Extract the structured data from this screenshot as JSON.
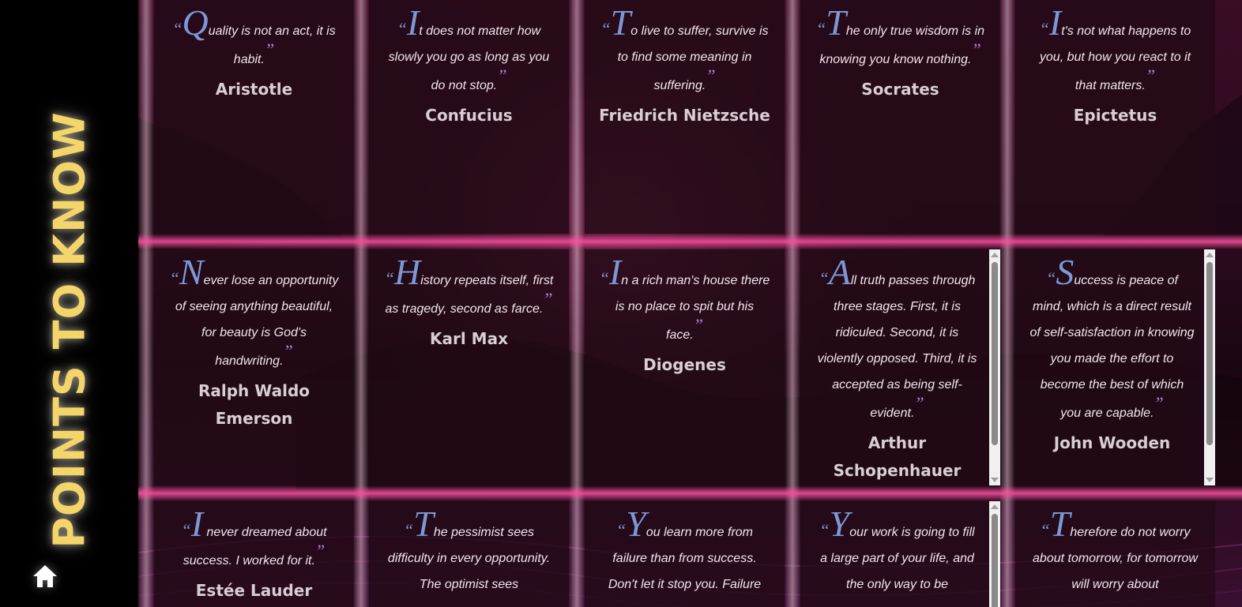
{
  "sidebar": {
    "title": "POINTS TO KNOW",
    "home_icon": "home-icon"
  },
  "colors": {
    "title": "#f3d56a",
    "quote_mark_open": "#7f92c9",
    "quote_mark_close": "#b680c7",
    "accent_glow": "#ff4fa3"
  },
  "quotes": [
    {
      "first": "Q",
      "rest": "uality is not an act, it is habit.",
      "author": "Aristotle"
    },
    {
      "first": "I",
      "rest": "t does not matter how slowly you go as long as you do not stop.",
      "author": "Confucius"
    },
    {
      "first": "T",
      "rest": "o live to suffer, survive is to find some meaning in suffering.",
      "author": "Friedrich Nietzsche"
    },
    {
      "first": "T",
      "rest": "he only true wisdom is in knowing you know nothing.",
      "author": "Socrates"
    },
    {
      "first": "I",
      "rest": "t's not what happens to you, but how you react to it that matters.",
      "author": "Epictetus"
    },
    {
      "first": "N",
      "rest": "ever lose an opportunity of seeing anything beautiful, for beauty is God's handwriting.",
      "author": "Ralph Waldo Emerson"
    },
    {
      "first": "H",
      "rest": "istory repeats itself, first as tragedy, second as farce.",
      "author": "Karl Max"
    },
    {
      "first": "I",
      "rest": "n a rich man's house there is no place to spit but his face.",
      "author": "Diogenes"
    },
    {
      "first": "A",
      "rest": "ll truth passes through three stages. First, it is ridiculed. Second, it is violently opposed. Third, it is accepted as being self-evident.",
      "author": "Arthur Schopenhauer"
    },
    {
      "first": "S",
      "rest": "uccess is peace of mind, which is a direct result of self-satisfaction in knowing you made the effort to become the best of which you are capable.",
      "author": "John Wooden"
    },
    {
      "first": "I",
      "rest": " never dreamed about success. I worked for it.",
      "author": "Estée Lauder"
    },
    {
      "first": "T",
      "rest": "he pessimist sees difficulty in every opportunity. The optimist sees",
      "author": ""
    },
    {
      "first": "Y",
      "rest": "ou learn more from failure than from success. Don't let it stop you. Failure",
      "author": ""
    },
    {
      "first": "Y",
      "rest": "our work is going to fill a large part of your life, and the only way to be",
      "author": ""
    },
    {
      "first": "T",
      "rest": "herefore do not worry about tomorrow, for tomorrow will worry about",
      "author": ""
    }
  ]
}
